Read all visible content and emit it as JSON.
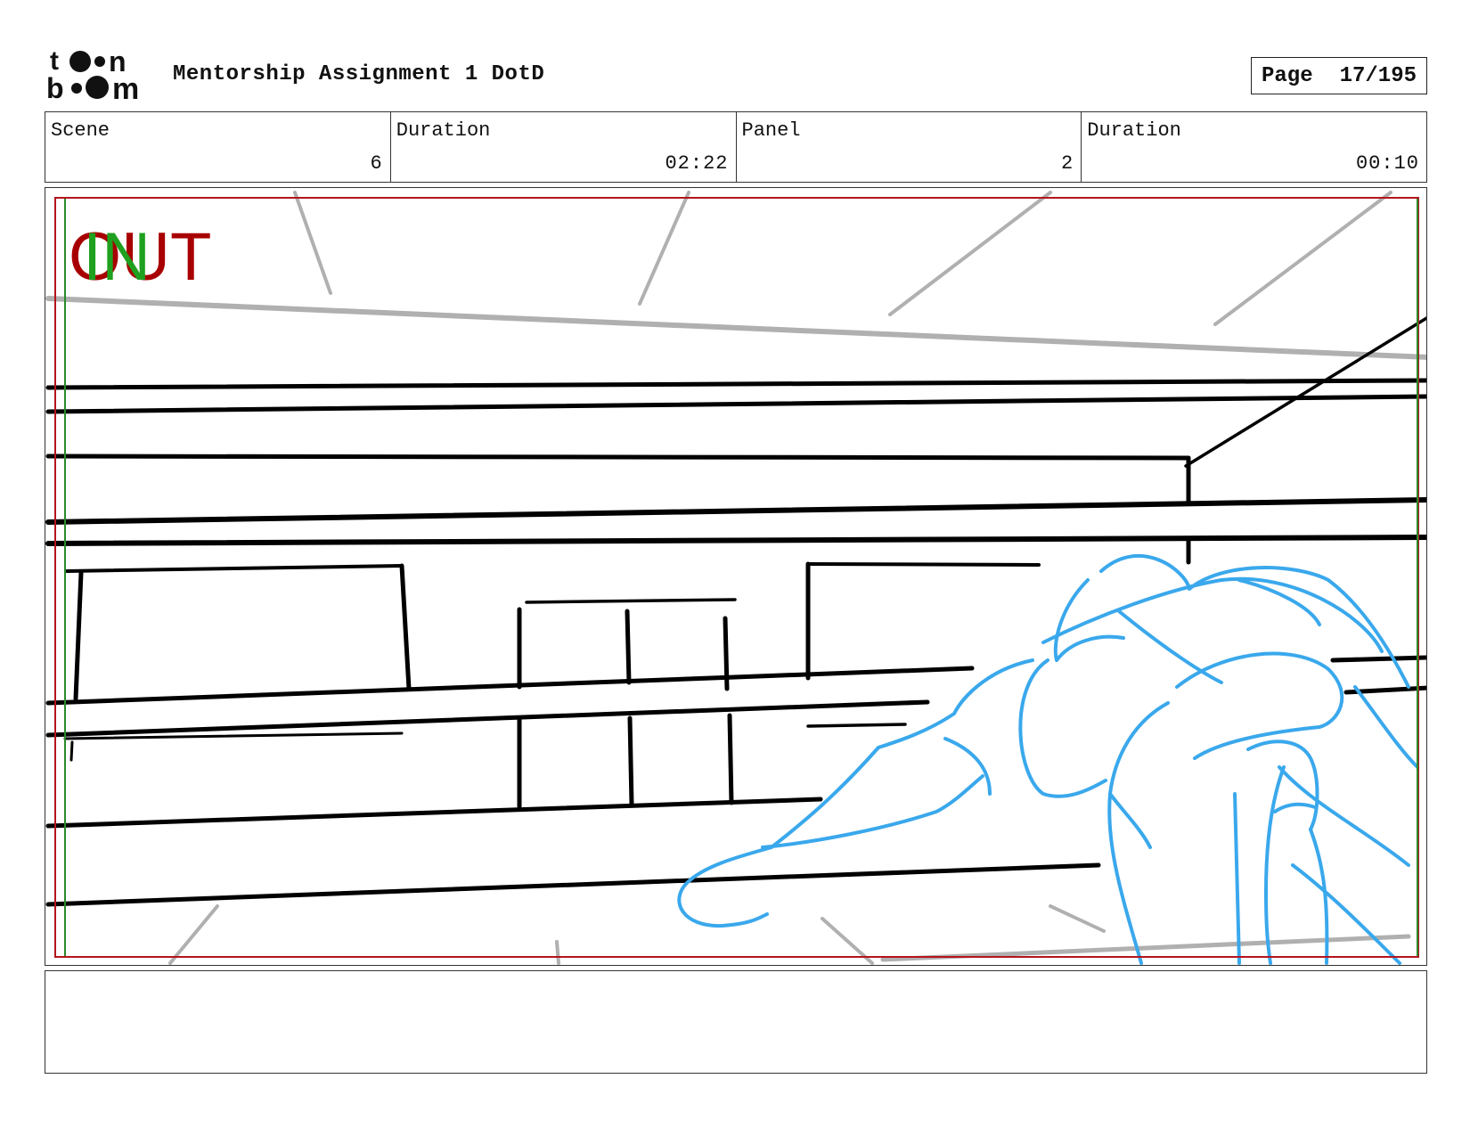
{
  "header": {
    "title": "Mentorship Assignment 1 DotD",
    "page_label": "Page",
    "page_value": "17/195"
  },
  "logo": {
    "icon": "toon-boom-logo-icon"
  },
  "info": {
    "scene_label": "Scene",
    "scene_value": "6",
    "scene_duration_label": "Duration",
    "scene_duration_value": "02:22",
    "panel_label": "Panel",
    "panel_value": "2",
    "panel_duration_label": "Duration",
    "panel_duration_value": "00:10"
  },
  "panel_markers": {
    "out_label": "OUT",
    "in_label": "IN",
    "out_color": "#a80000",
    "in_color": "#1fa01f"
  },
  "sketch_colors": {
    "ink": "#000000",
    "guide": "#b0b0b0",
    "figure": "#3aa8ec",
    "frame_red": "#b4141e",
    "frame_green": "#2a8a2a"
  },
  "notes": {
    "text": ""
  }
}
